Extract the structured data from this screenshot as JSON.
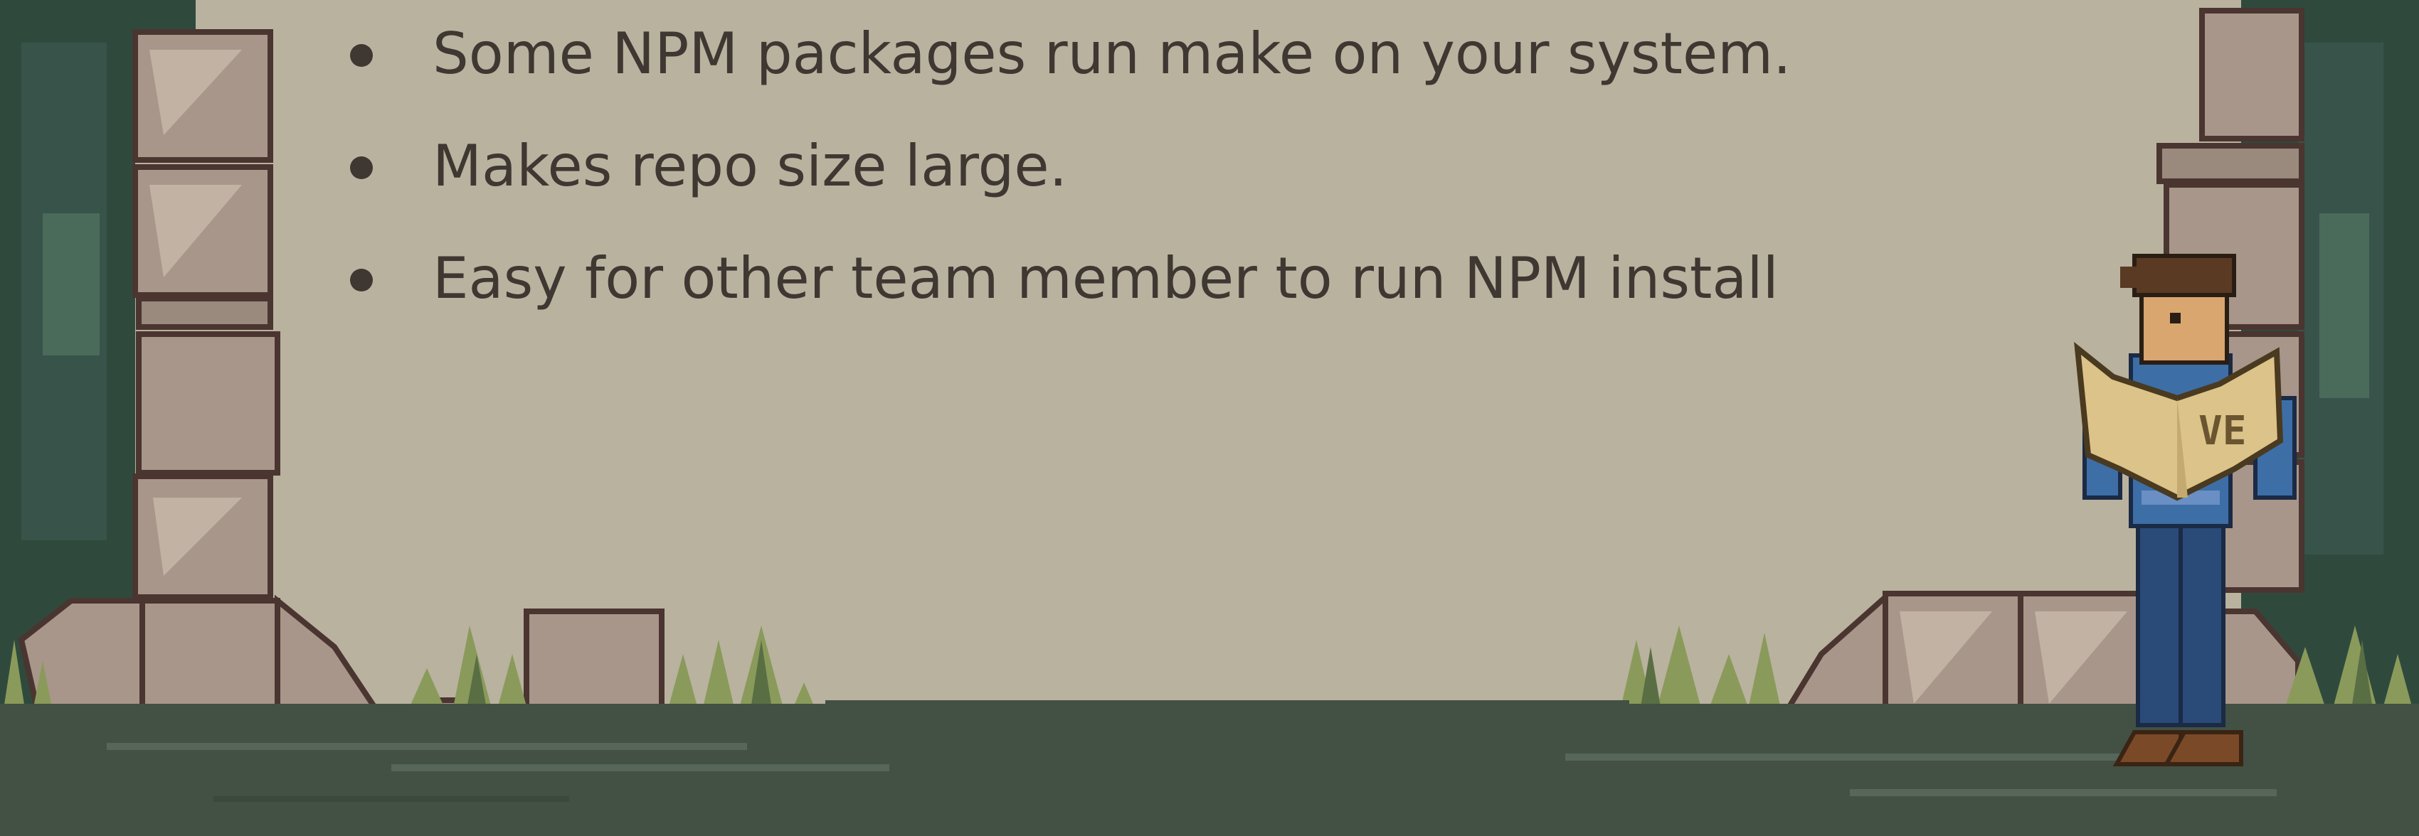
{
  "slide": {
    "bullets": [
      "Some NPM packages run make on your system.",
      "Makes repo size large.",
      "Easy for other team member to run NPM install"
    ]
  },
  "illustration": {
    "map_label": "VE",
    "colors": {
      "background": "#b9b29f",
      "text": "#3f3731",
      "foliage_dark": "#2f4a3d",
      "ground": "#425143",
      "stone": "#a8968a",
      "grass": "#8a9a5a",
      "shirt": "#3d6ea6",
      "pants": "#2a4a78",
      "map": "#dcc389"
    }
  }
}
